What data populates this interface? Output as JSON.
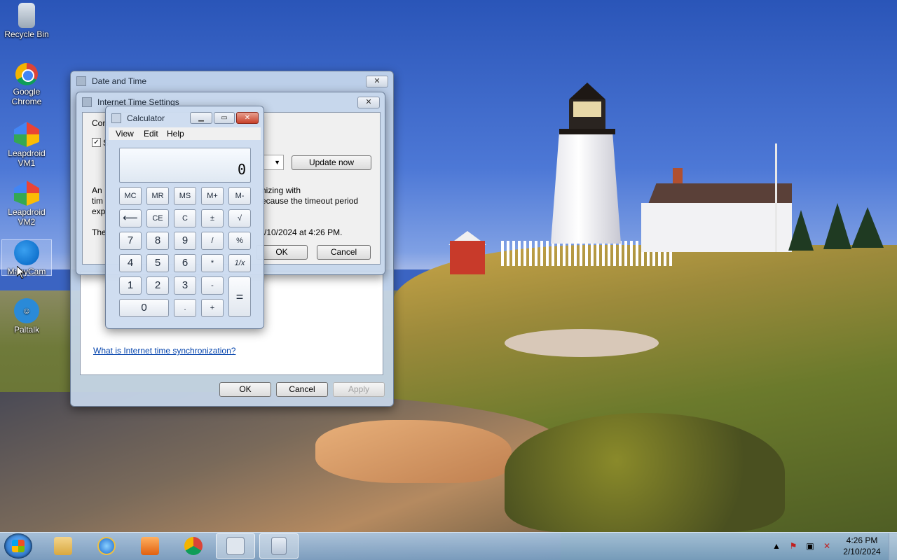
{
  "desktop": {
    "icons": [
      {
        "label": "Recycle Bin",
        "icon": "recycle-bin-icon"
      },
      {
        "label": "Google Chrome",
        "icon": "chrome-icon"
      },
      {
        "label": "Leapdroid VM1",
        "icon": "leapdroid-icon"
      },
      {
        "label": "Leapdroid VM2",
        "icon": "leapdroid-icon"
      },
      {
        "label": "ManyCam",
        "icon": "manycam-icon"
      },
      {
        "label": "Paltalk",
        "icon": "paltalk-icon"
      }
    ]
  },
  "date_time_window": {
    "title": "Date and Time",
    "close_label": "✕",
    "link_text": "What is Internet time synchronization?",
    "ok": "OK",
    "cancel": "Cancel",
    "apply": "Apply"
  },
  "internet_time_window": {
    "title": "Internet Time Settings",
    "close_label": "✕",
    "config_prefix": "Con",
    "checkbox_prefix": "S",
    "update_now": "Update now",
    "error_line1_prefix": "An",
    "error_line1_suffix": "nizing with",
    "error_line2_prefix": "tim",
    "error_line2_suffix": "ecause the timeout period",
    "error_line3_prefix": "exp",
    "status_prefix": "The",
    "status_suffix": "/10/2024 at 4:26 PM.",
    "ok": "OK",
    "cancel": "Cancel"
  },
  "calculator": {
    "title": "Calculator",
    "menu": [
      "View",
      "Edit",
      "Help"
    ],
    "display": "0",
    "memory_row": [
      "MC",
      "MR",
      "MS",
      "M+",
      "M-"
    ],
    "row2": [
      "⟵",
      "CE",
      "C",
      "±",
      "√"
    ],
    "row3": [
      "7",
      "8",
      "9",
      "/",
      "%"
    ],
    "row4": [
      "4",
      "5",
      "6",
      "*",
      "1/x"
    ],
    "row5": [
      "1",
      "2",
      "3",
      "-"
    ],
    "row6": [
      "0",
      ".",
      "+"
    ],
    "equals": "="
  },
  "taskbar": {
    "apps": [
      {
        "icon": "file-explorer-icon",
        "active": false
      },
      {
        "icon": "internet-explorer-icon",
        "active": false
      },
      {
        "icon": "media-player-icon",
        "active": false
      },
      {
        "icon": "chrome-icon",
        "active": false
      },
      {
        "icon": "date-time-icon",
        "active": true
      },
      {
        "icon": "calculator-icon",
        "active": true
      }
    ],
    "time": "4:26 PM",
    "date": "2/10/2024",
    "tray_icons": [
      "show-hidden-icons-icon",
      "action-center-icon",
      "network-icon",
      "volume-icon"
    ]
  },
  "colors": {
    "link": "#0645ad",
    "calc_close": "#c8402a",
    "taskbar": "#7aa0c8"
  }
}
